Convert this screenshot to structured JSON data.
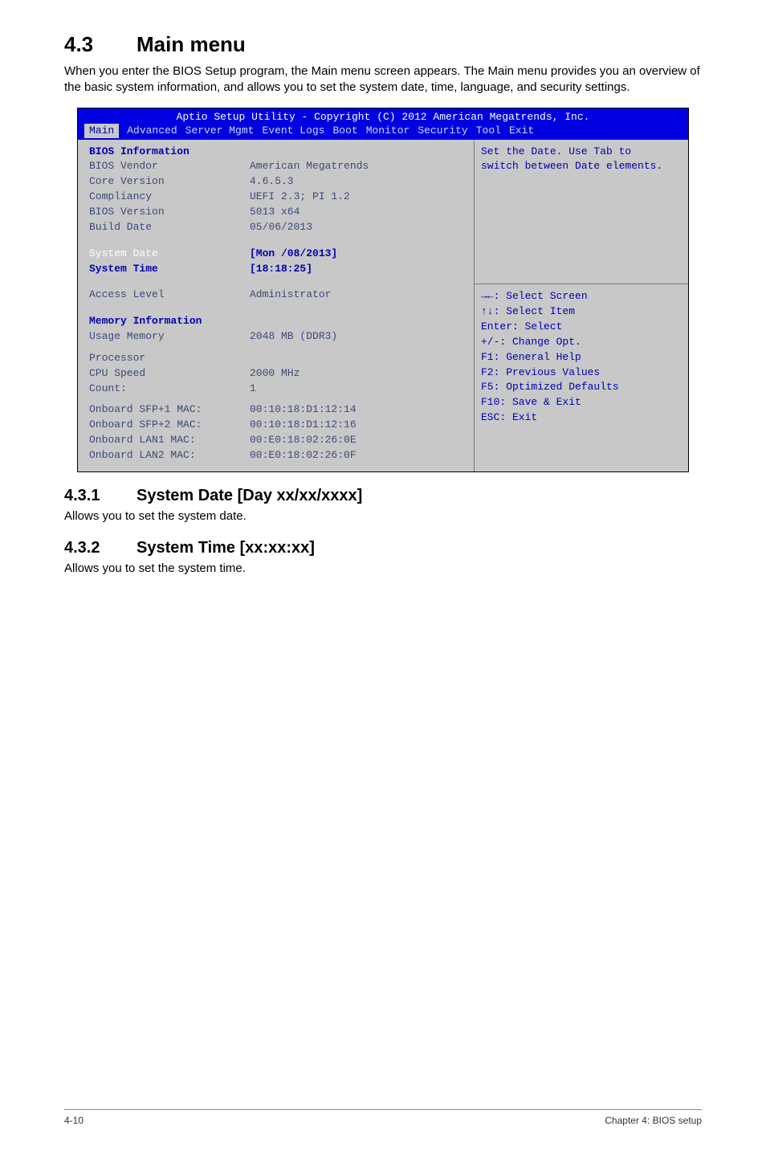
{
  "section": {
    "heading_num": "4.3",
    "heading_text": "Main menu",
    "intro": "When you enter the BIOS Setup program, the Main menu screen appears. The Main menu provides you an overview of the basic system information, and allows you to set the system date, time, language, and security settings."
  },
  "bios": {
    "title": "Aptio Setup Utility - Copyright (C) 2012 American Megatrends, Inc.",
    "menu": [
      "Main",
      "Advanced",
      "Server Mgmt",
      "Event Logs",
      "Boot",
      "Monitor",
      "Security",
      "Tool",
      "Exit"
    ],
    "left": {
      "bios_info_header": "BIOS Information",
      "vendor_label": "BIOS Vendor",
      "vendor_value": "American Megatrends",
      "core_label": "Core Version",
      "core_value": "4.6.5.3",
      "compliancy_label": "Compliancy",
      "compliancy_value": "UEFI 2.3; PI 1.2",
      "biosver_label": "BIOS Version",
      "biosver_value": "5013 x64",
      "build_label": "Build Date",
      "build_value": "05/06/2013",
      "sysdate_label": "System Date",
      "sysdate_value": "[Mon   /08/2013]",
      "systime_label": "System Time",
      "systime_value": "[18:18:25]",
      "access_label": "Access Level",
      "access_value": "Administrator",
      "mem_header": "Memory Information",
      "usage_label": "Usage Memory",
      "usage_value": "2048 MB (DDR3)",
      "proc_header": "Processor",
      "cpuspeed_label": "CPU Speed",
      "cpuspeed_value": "2000 MHz",
      "count_label": "Count:",
      "count_value": "1",
      "mac1_label": "Onboard SFP+1 MAC:",
      "mac1_value": "00:10:18:D1:12:14",
      "mac2_label": "Onboard SFP+2 MAC:",
      "mac2_value": "00:10:18:D1:12:16",
      "mac3_label": "Onboard LAN1 MAC:",
      "mac3_value": "00:E0:18:02:26:0E",
      "mac4_label": "Onboard LAN2 MAC:",
      "mac4_value": "00:E0:18:02:26:0F"
    },
    "right": {
      "help1": "Set the Date. Use Tab to",
      "help2": "switch between Date elements.",
      "k1": "→←: Select Screen",
      "k2": "↑↓: Select Item",
      "k3": "Enter: Select",
      "k4": "+/-: Change Opt.",
      "k5": "F1: General Help",
      "k6": "F2: Previous Values",
      "k7": "F5: Optimized Defaults",
      "k8": "F10: Save & Exit",
      "k9": "ESC: Exit"
    }
  },
  "sub1": {
    "num": "4.3.1",
    "title": "System Date [Day xx/xx/xxxx]",
    "text": "Allows you to set the system date."
  },
  "sub2": {
    "num": "4.3.2",
    "title": "System Time [xx:xx:xx]",
    "text": "Allows you to set the system time."
  },
  "footer": {
    "left": "4-10",
    "right": "Chapter 4: BIOS setup"
  }
}
